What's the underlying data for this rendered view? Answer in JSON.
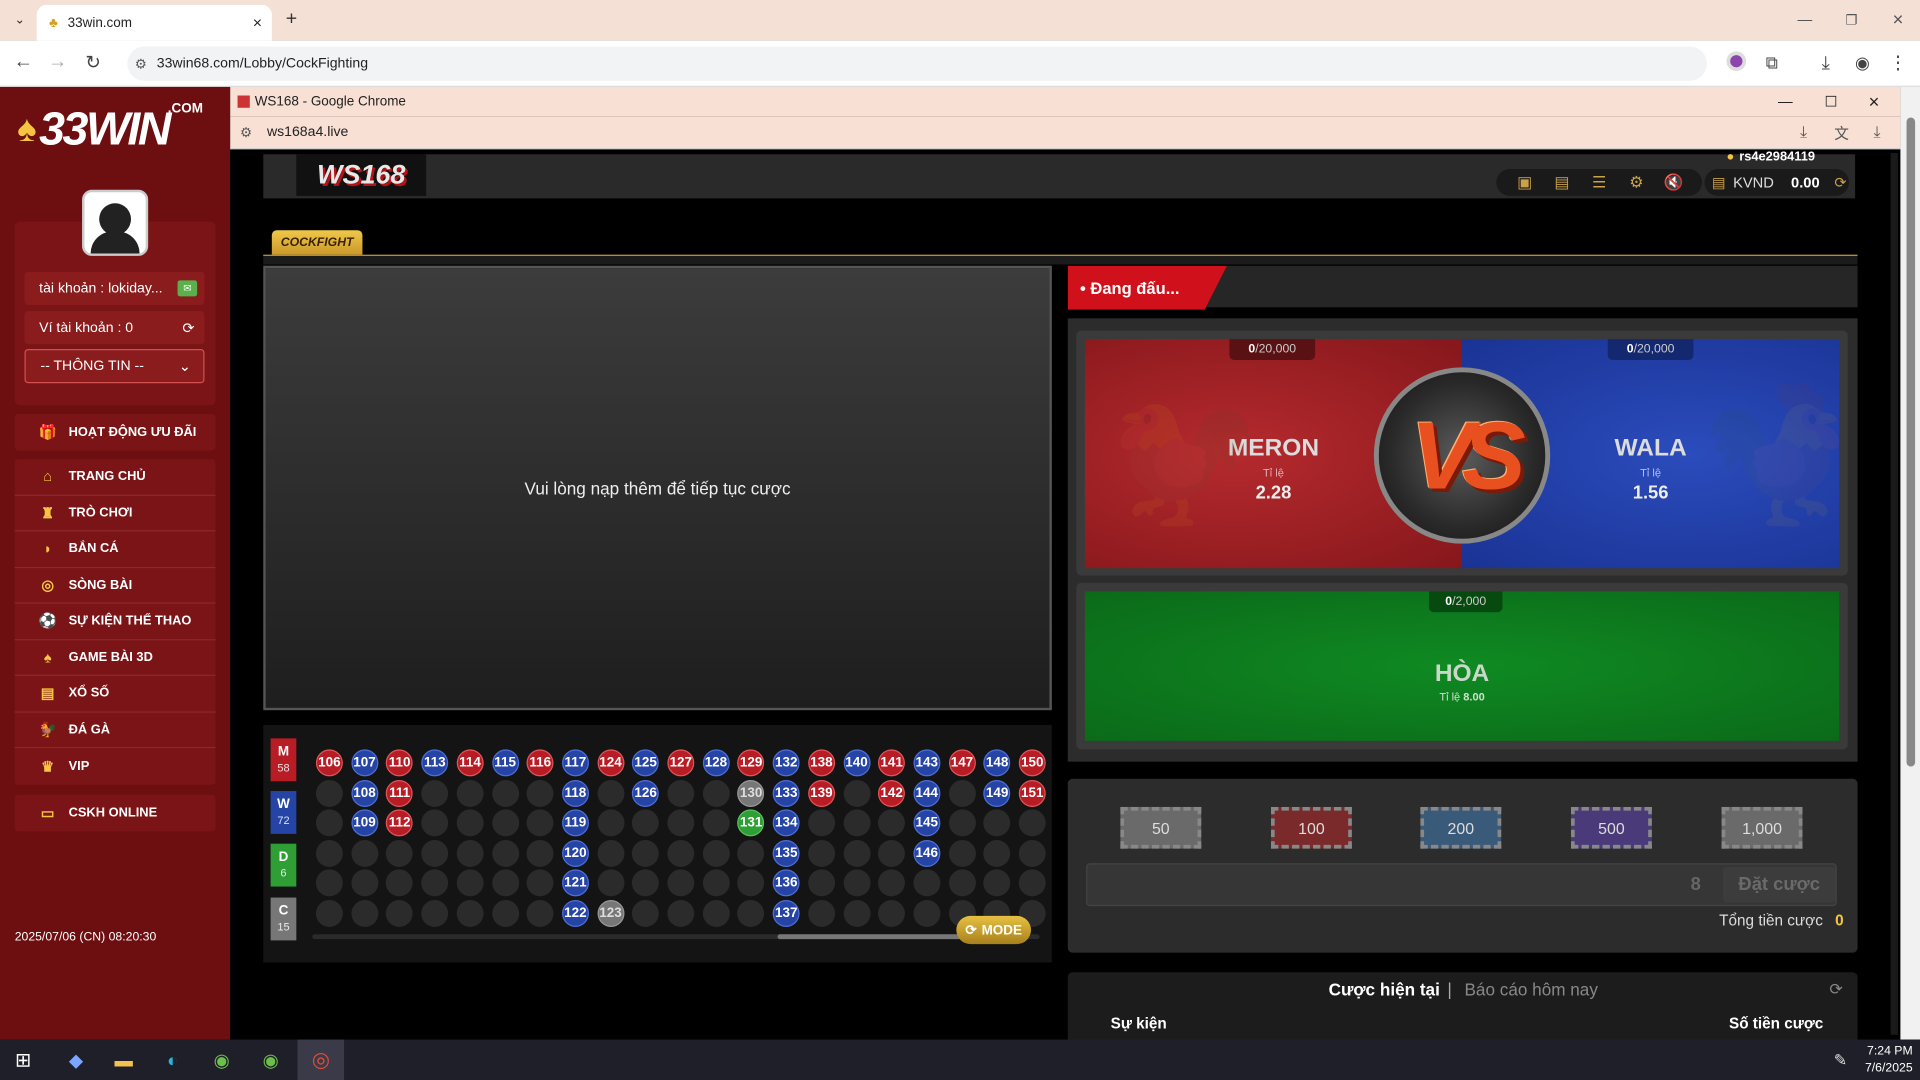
{
  "browser": {
    "tab_title": "33win.com",
    "url": "33win68.com/Lobby/CockFighting"
  },
  "site": {
    "logo": "33WIN",
    "logo_suffix": ".COM",
    "account_label": "tài khoản : lokiday...",
    "wallet_label": "Ví tài khoản : 0",
    "info_select": "-- THÔNG TIN --",
    "promo": "HOẠT ĐỘNG ƯU ĐÃI",
    "menu": [
      "TRANG CHỦ",
      "TRÒ CHƠI",
      "BẮN CÁ",
      "SÒNG BÀI",
      "SỰ KIỆN THỂ THAO",
      "GAME BÀI 3D",
      "XỔ SỐ",
      "ĐÁ GÀ",
      "VIP"
    ],
    "support": "CSKH ONLINE",
    "datetime": "2025/07/06 (CN) 08:20:30"
  },
  "popup": {
    "title": "WS168 - Google Chrome",
    "url": "ws168a4.live"
  },
  "game": {
    "logo": "WS168",
    "username": "rs4e2984119",
    "currency": "KVND",
    "balance": "0.00",
    "tab": "COCKFIGHT",
    "status": "• Đang đấu...",
    "video_message": "Vui lòng nạp thêm để tiếp tục cược",
    "meron": {
      "name": "MERON",
      "odds_label": "Tỉ lệ",
      "odds": "2.28",
      "limit_cur": "0",
      "limit_max": "/20,000"
    },
    "wala": {
      "name": "WALA",
      "odds_label": "Tỉ lệ",
      "odds": "1.56",
      "limit_cur": "0",
      "limit_max": "/20,000"
    },
    "draw": {
      "name": "HÒA",
      "odds_label": "Tỉ lệ",
      "odds": "8.00",
      "limit_cur": "0",
      "limit_max": "/2,000"
    },
    "vs": "VS",
    "chips": [
      "50",
      "100",
      "200",
      "500",
      "1,000"
    ],
    "bet_input_value": "8",
    "bet_button": "Đặt cược",
    "total_label": "Tổng tiền cược",
    "total_value": "0",
    "tab_current": "Cược hiện tại",
    "tab_separator": "|",
    "tab_report": "Báo cáo hôm nay",
    "col_event": "Sự kiện",
    "col_amount": "Số tiền cược",
    "mode_button": "MODE"
  },
  "road_summary": [
    {
      "letter": "M",
      "count": "58",
      "color": "#b81d25"
    },
    {
      "letter": "W",
      "count": "72",
      "color": "#2544a6"
    },
    {
      "letter": "D",
      "count": "6",
      "color": "#2e9e35"
    },
    {
      "letter": "C",
      "count": "15",
      "color": "#777777"
    }
  ],
  "road_columns": [
    [
      [
        "106",
        "r"
      ]
    ],
    [
      [
        "107",
        "b"
      ],
      [
        "108",
        "b"
      ],
      [
        "109",
        "b"
      ]
    ],
    [
      [
        "110",
        "r"
      ],
      [
        "111",
        "r"
      ],
      [
        "112",
        "r"
      ]
    ],
    [
      [
        "113",
        "b"
      ]
    ],
    [
      [
        "114",
        "r"
      ]
    ],
    [
      [
        "115",
        "b"
      ]
    ],
    [
      [
        "116",
        "r"
      ]
    ],
    [
      [
        "117",
        "b"
      ],
      [
        "118",
        "b"
      ],
      [
        "119",
        "b"
      ],
      [
        "120",
        "b"
      ],
      [
        "121",
        "b"
      ],
      [
        "122",
        "b"
      ]
    ],
    [
      [
        "124",
        "r"
      ],
      [
        "",
        "e"
      ],
      [
        "",
        "e"
      ],
      [
        "",
        "e"
      ],
      [
        "",
        "e"
      ],
      [
        "123",
        "gr"
      ]
    ],
    [
      [
        "125",
        "b"
      ],
      [
        "126",
        "b"
      ]
    ],
    [
      [
        "127",
        "r"
      ]
    ],
    [
      [
        "128",
        "b"
      ]
    ],
    [
      [
        "129",
        "r"
      ],
      [
        "130",
        "gr"
      ],
      [
        "131",
        "g"
      ]
    ],
    [
      [
        "132",
        "b"
      ],
      [
        "133",
        "b"
      ],
      [
        "134",
        "b"
      ],
      [
        "135",
        "b"
      ],
      [
        "136",
        "b"
      ],
      [
        "137",
        "b"
      ]
    ],
    [
      [
        "138",
        "r"
      ],
      [
        "139",
        "r"
      ]
    ],
    [
      [
        "140",
        "b"
      ]
    ],
    [
      [
        "141",
        "r"
      ],
      [
        "142",
        "r"
      ]
    ],
    [
      [
        "143",
        "b"
      ],
      [
        "144",
        "b"
      ],
      [
        "145",
        "b"
      ],
      [
        "146",
        "b"
      ]
    ],
    [
      [
        "147",
        "r"
      ]
    ],
    [
      [
        "148",
        "b"
      ],
      [
        "149",
        "b"
      ]
    ],
    [
      [
        "150",
        "r"
      ],
      [
        "151",
        "r"
      ]
    ]
  ],
  "taskbar": {
    "time": "7:24 PM",
    "date": "7/6/2025"
  },
  "colors": {
    "meron": "#b01c22",
    "wala": "#1f3fa8",
    "draw": "#0c7a1f",
    "gold": "#f5c542"
  }
}
